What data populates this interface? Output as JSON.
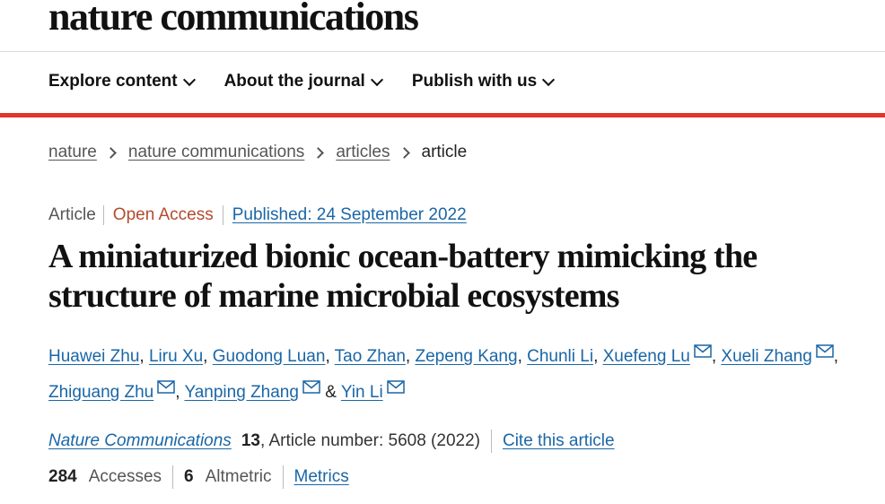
{
  "site": {
    "brand": "nature communications"
  },
  "nav": {
    "items": [
      {
        "label": "Explore content",
        "icon": "chevron-down-icon"
      },
      {
        "label": "About the journal",
        "icon": "chevron-down-icon"
      },
      {
        "label": "Publish with us",
        "icon": "chevron-down-icon"
      }
    ]
  },
  "breadcrumb": {
    "items": [
      "nature",
      "nature communications",
      "articles"
    ],
    "current": "article"
  },
  "article": {
    "type": "Article",
    "access": "Open Access",
    "published_label": "Published: ",
    "published_date": "24 September 2022",
    "title": "A miniaturized bionic ocean-battery mimicking the structure of marine microbial ecosystems",
    "authors": [
      {
        "name": "Huawei Zhu",
        "email_icon": false
      },
      {
        "name": "Liru Xu",
        "email_icon": false
      },
      {
        "name": "Guodong Luan",
        "email_icon": false
      },
      {
        "name": "Tao Zhan",
        "email_icon": false
      },
      {
        "name": "Zepeng Kang",
        "email_icon": false
      },
      {
        "name": "Chunli Li",
        "email_icon": false
      },
      {
        "name": "Xuefeng Lu",
        "email_icon": true
      },
      {
        "name": "Xueli Zhang",
        "email_icon": true
      },
      {
        "name": "Zhiguang Zhu",
        "email_icon": true
      },
      {
        "name": "Yanping Zhang",
        "email_icon": true
      },
      {
        "name": "Yin Li",
        "email_icon": true
      }
    ],
    "author_separator": ", ",
    "author_last_separator": " & ",
    "journal": "Nature Communications",
    "volume": "13",
    "article_number_text": ", Article number: 5608 (2022)",
    "cite_label": "Cite this article"
  },
  "metrics": {
    "accesses_value": "284",
    "accesses_label": "Accesses",
    "altmetric_value": "6",
    "altmetric_label": "Altmetric",
    "metrics_link": "Metrics"
  },
  "colors": {
    "accent_red": "#e0362b",
    "link_blue": "#1a66a6",
    "open_access": "#b24b2f"
  }
}
